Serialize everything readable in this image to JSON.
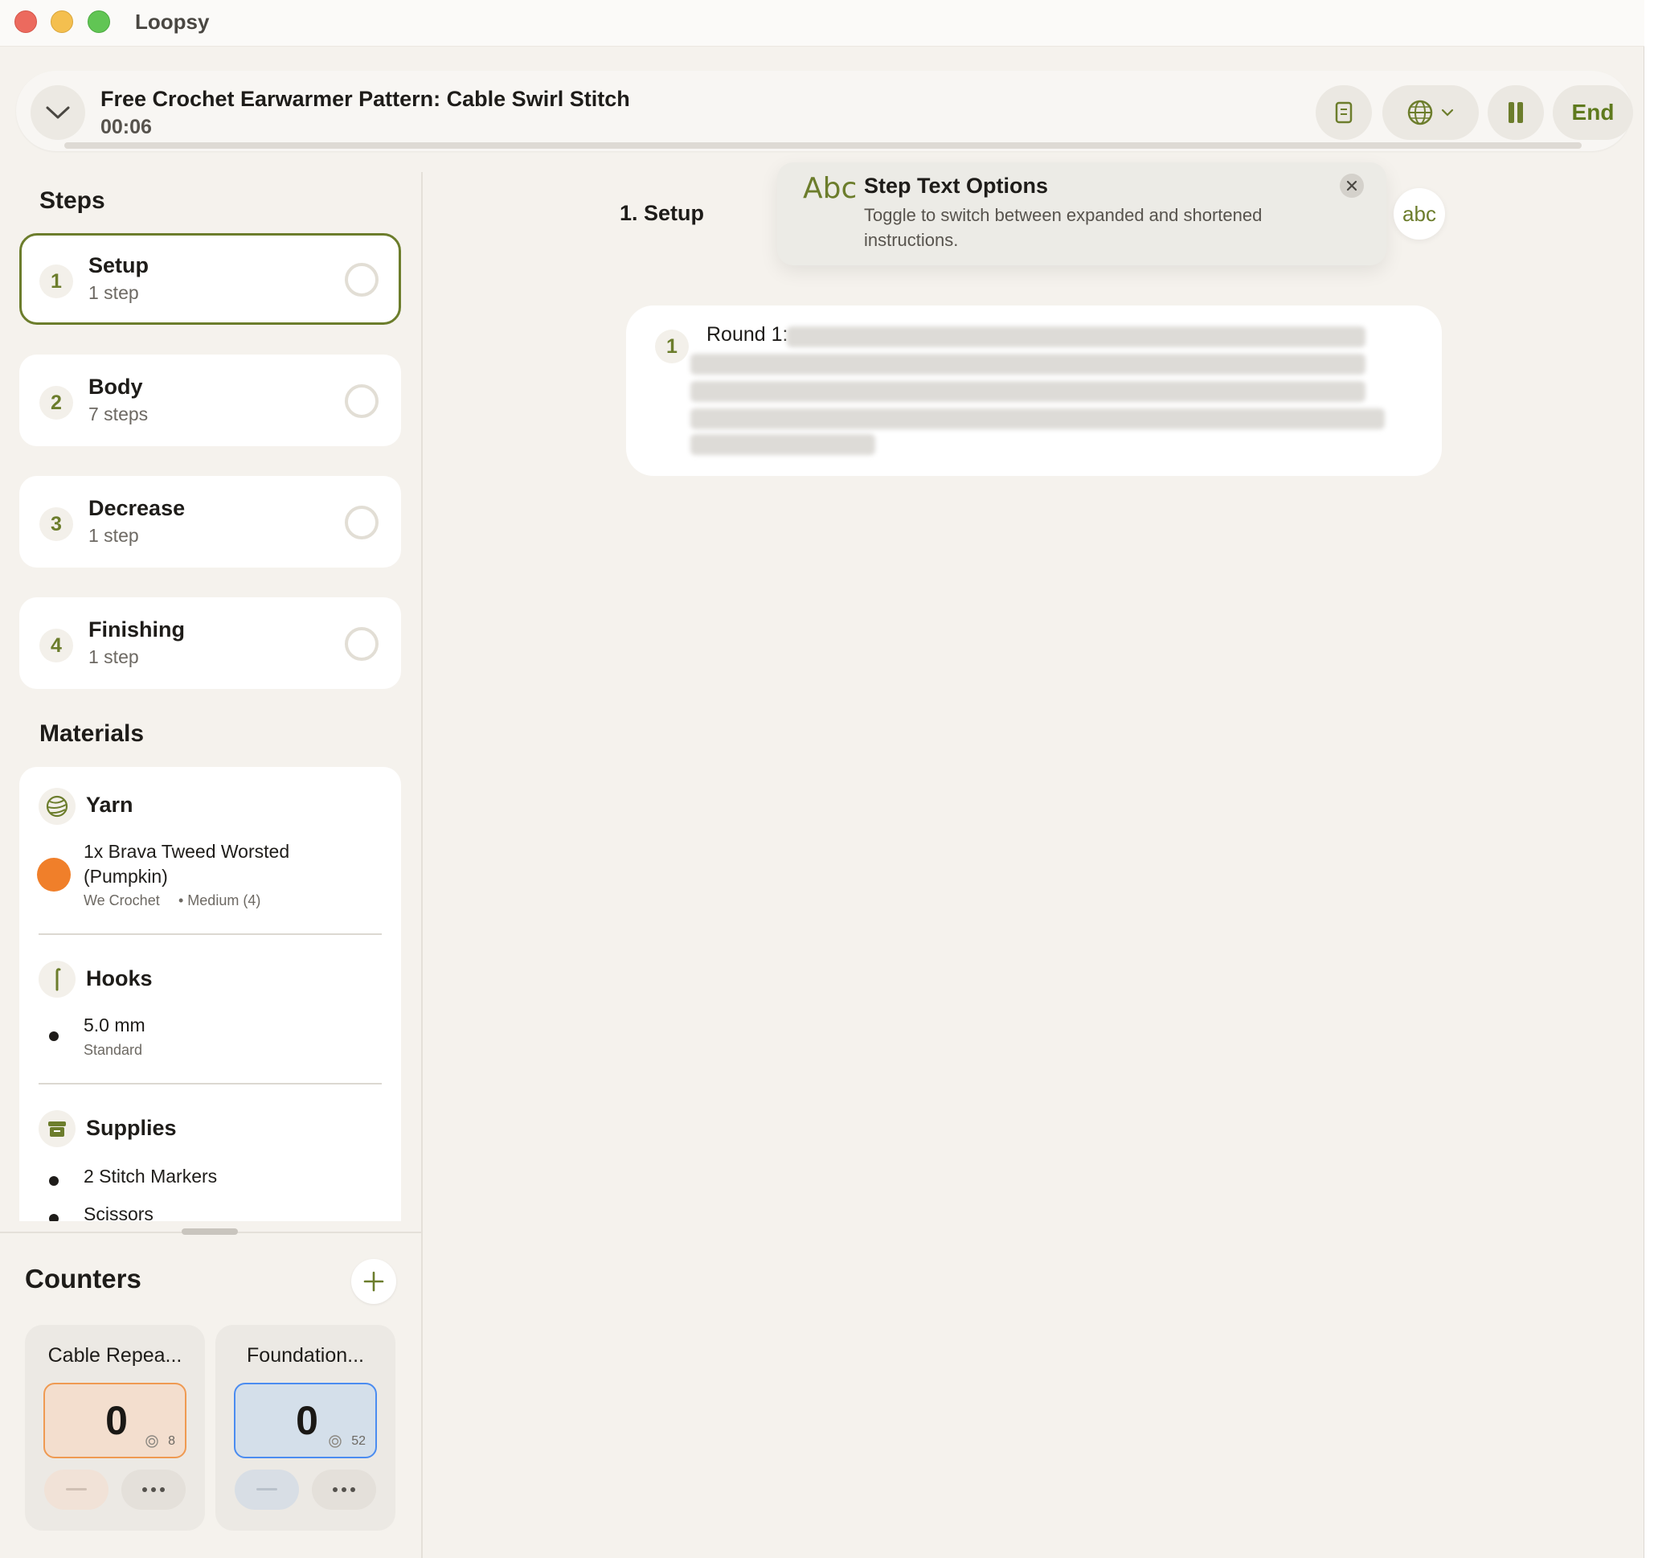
{
  "app": {
    "title": "Loopsy"
  },
  "session": {
    "title": "Free Crochet Earwarmer Pattern: Cable Swirl Stitch",
    "time": "00:06",
    "end_label": "End"
  },
  "steps_section": {
    "heading": "Steps",
    "items": [
      {
        "num": "1",
        "name": "Setup",
        "sub": "1 step"
      },
      {
        "num": "2",
        "name": "Body",
        "sub": "7 steps"
      },
      {
        "num": "3",
        "name": "Decrease",
        "sub": "1 step"
      },
      {
        "num": "4",
        "name": "Finishing",
        "sub": "1 step"
      }
    ]
  },
  "materials": {
    "heading": "Materials",
    "yarn": {
      "title": "Yarn",
      "line1": "1x Brava Tweed Worsted",
      "line2": "(Pumpkin)",
      "brand": "We Crochet",
      "weight": "• Medium (4)",
      "swatch_color": "#f07f2a"
    },
    "hooks": {
      "title": "Hooks",
      "size": "5.0 mm",
      "type": "Standard"
    },
    "supplies": {
      "title": "Supplies",
      "items": [
        "2 Stitch Markers",
        "Scissors"
      ]
    }
  },
  "counters": {
    "heading": "Counters",
    "items": [
      {
        "name": "Cable Repea...",
        "value": "0",
        "target": "8",
        "color": "orange"
      },
      {
        "name": "Foundation...",
        "value": "0",
        "target": "52",
        "color": "blue"
      }
    ]
  },
  "main": {
    "step_heading": "1. Setup",
    "tooltip": {
      "icon_text": "Abc",
      "title": "Step Text Options",
      "body": "Toggle to switch between expanded and shortened instructions."
    },
    "toggle_label": "abc",
    "instruction": {
      "num": "1",
      "label": "Round 1:"
    }
  },
  "colors": {
    "accent": "#6c7d2c",
    "background": "#f5f2ed"
  }
}
